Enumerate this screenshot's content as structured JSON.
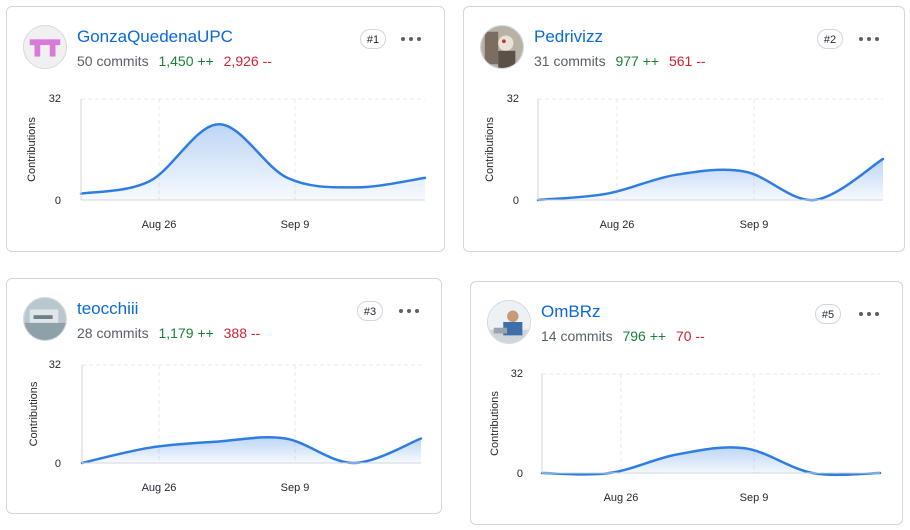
{
  "common": {
    "ylabel": "Contributions",
    "y_ticks": [
      "32",
      "0"
    ],
    "x_ticks": [
      "Aug 26",
      "Sep 9"
    ],
    "ellipsis_label": "…"
  },
  "contributors": [
    {
      "username": "GonzaQuedenaUPC",
      "rank": "#1",
      "commits": "50 commits",
      "additions": "1,450 ++",
      "deletions": "2,926 --",
      "avatar": "pink-identicon"
    },
    {
      "username": "Pedrivizz",
      "rank": "#2",
      "commits": "31 commits",
      "additions": "977 ++",
      "deletions": "561 --",
      "avatar": "photo"
    },
    {
      "username": "teocchiii",
      "rank": "#3",
      "commits": "28 commits",
      "additions": "1,179 ++",
      "deletions": "388 --",
      "avatar": "photo"
    },
    {
      "username": "OmBRz",
      "rank": "#5",
      "commits": "14 commits",
      "additions": "796 ++",
      "deletions": "70 --",
      "avatar": "photo"
    }
  ],
  "chart_data": [
    {
      "type": "area",
      "ylabel": "Contributions",
      "ylim": [
        0,
        32
      ],
      "x_tick_labels": [
        "Aug 26",
        "Sep 9"
      ],
      "x": [
        "Aug 18",
        "Aug 25",
        "Sep 1",
        "Sep 8",
        "Sep 15",
        "Sep 22"
      ],
      "values": [
        2,
        6,
        24,
        7,
        4,
        7
      ],
      "grid": true,
      "color": "#2f7de1"
    },
    {
      "type": "area",
      "ylabel": "Contributions",
      "ylim": [
        0,
        32
      ],
      "x_tick_labels": [
        "Aug 26",
        "Sep 9"
      ],
      "x": [
        "Aug 18",
        "Aug 25",
        "Sep 1",
        "Sep 8",
        "Sep 15",
        "Sep 22"
      ],
      "values": [
        0,
        2,
        8,
        9,
        0,
        13
      ],
      "grid": true,
      "color": "#2f7de1"
    },
    {
      "type": "area",
      "ylabel": "Contributions",
      "ylim": [
        0,
        32
      ],
      "x_tick_labels": [
        "Aug 26",
        "Sep 9"
      ],
      "x": [
        "Aug 18",
        "Aug 25",
        "Sep 1",
        "Sep 8",
        "Sep 15",
        "Sep 22"
      ],
      "values": [
        0,
        5,
        7,
        8,
        0,
        8
      ],
      "grid": true,
      "color": "#2f7de1"
    },
    {
      "type": "area",
      "ylabel": "Contributions",
      "ylim": [
        0,
        32
      ],
      "x_tick_labels": [
        "Aug 26",
        "Sep 9"
      ],
      "x": [
        "Aug 18",
        "Aug 25",
        "Sep 1",
        "Sep 8",
        "Sep 15",
        "Sep 22"
      ],
      "values": [
        0,
        0,
        6,
        8,
        0,
        0
      ],
      "grid": true,
      "color": "#2f7de1"
    }
  ]
}
